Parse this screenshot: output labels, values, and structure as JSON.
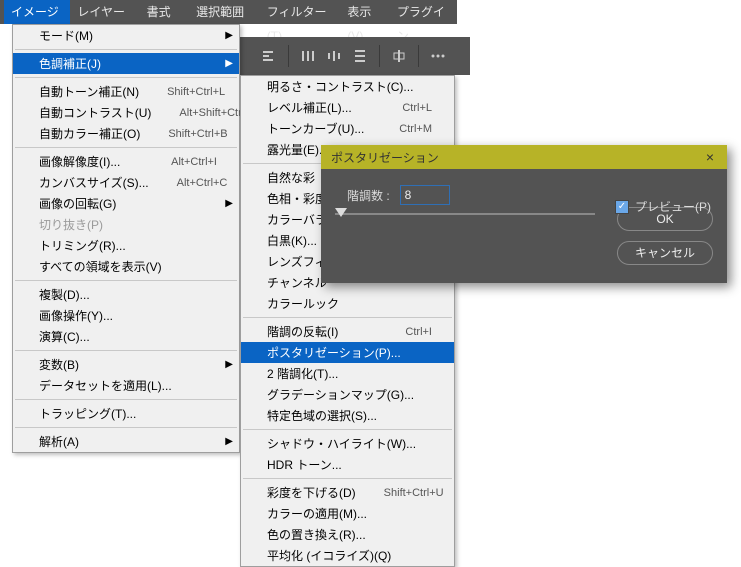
{
  "menubar": {
    "items": [
      "イメージ(I)",
      "レイヤー(L)",
      "書式(Y)",
      "選択範囲(S)",
      "フィルター(T)",
      "表示(V)",
      "プラグイン"
    ],
    "active_index": 0
  },
  "menu_image": {
    "items": [
      {
        "label": "モード(M)",
        "arrow": true
      },
      {
        "sep": true
      },
      {
        "label": "色調補正(J)",
        "arrow": true,
        "hl": true
      },
      {
        "sep": true
      },
      {
        "label": "自動トーン補正(N)",
        "accel": "Shift+Ctrl+L"
      },
      {
        "label": "自動コントラスト(U)",
        "accel": "Alt+Shift+Ctrl+L"
      },
      {
        "label": "自動カラー補正(O)",
        "accel": "Shift+Ctrl+B"
      },
      {
        "sep": true
      },
      {
        "label": "画像解像度(I)...",
        "accel": "Alt+Ctrl+I"
      },
      {
        "label": "カンバスサイズ(S)...",
        "accel": "Alt+Ctrl+C"
      },
      {
        "label": "画像の回転(G)",
        "arrow": true
      },
      {
        "label": "切り抜き(P)",
        "disabled": true
      },
      {
        "label": "トリミング(R)..."
      },
      {
        "label": "すべての領域を表示(V)"
      },
      {
        "sep": true
      },
      {
        "label": "複製(D)..."
      },
      {
        "label": "画像操作(Y)..."
      },
      {
        "label": "演算(C)..."
      },
      {
        "sep": true
      },
      {
        "label": "変数(B)",
        "arrow": true
      },
      {
        "label": "データセットを適用(L)..."
      },
      {
        "sep": true
      },
      {
        "label": "トラッピング(T)..."
      },
      {
        "sep": true
      },
      {
        "label": "解析(A)",
        "arrow": true
      }
    ]
  },
  "menu_adjust": {
    "items": [
      {
        "label": "明るさ・コントラスト(C)..."
      },
      {
        "label": "レベル補正(L)...",
        "accel": "Ctrl+L"
      },
      {
        "label": "トーンカーブ(U)...",
        "accel": "Ctrl+M"
      },
      {
        "label": "露光量(E)..."
      },
      {
        "sep": true
      },
      {
        "label": "自然な彩"
      },
      {
        "label": "色相・彩度"
      },
      {
        "label": "カラーバラン"
      },
      {
        "label": "白黒(K)..."
      },
      {
        "label": "レンズフィル"
      },
      {
        "label": "チャンネル"
      },
      {
        "label": "カラールック"
      },
      {
        "sep": true
      },
      {
        "label": "階調の反転(I)",
        "accel": "Ctrl+I"
      },
      {
        "label": "ポスタリゼーション(P)...",
        "hl": true
      },
      {
        "label": "2 階調化(T)..."
      },
      {
        "label": "グラデーションマップ(G)..."
      },
      {
        "label": "特定色域の選択(S)..."
      },
      {
        "sep": true
      },
      {
        "label": "シャドウ・ハイライト(W)..."
      },
      {
        "label": "HDR トーン..."
      },
      {
        "sep": true
      },
      {
        "label": "彩度を下げる(D)",
        "accel": "Shift+Ctrl+U"
      },
      {
        "label": "カラーの適用(M)..."
      },
      {
        "label": "色の置き換え(R)..."
      },
      {
        "label": "平均化 (イコライズ)(Q)"
      }
    ]
  },
  "dialog": {
    "title": "ポスタリゼーション",
    "field_label": "階調数 :",
    "field_value": "8",
    "ok": "OK",
    "cancel": "キャンセル",
    "preview": "プレビュー(P)"
  }
}
